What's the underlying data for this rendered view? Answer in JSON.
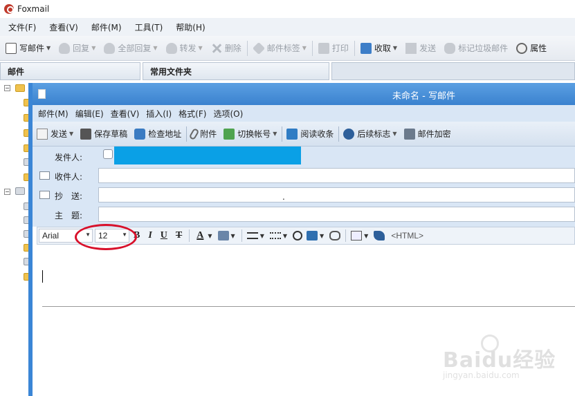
{
  "app": {
    "title": "Foxmail"
  },
  "menubar": [
    "文件(F)",
    "查看(V)",
    "邮件(M)",
    "工具(T)",
    "帮助(H)"
  ],
  "toolbar": {
    "write": "写邮件",
    "reply": "回复",
    "reply_all": "全部回复",
    "forward": "转发",
    "delete": "删除",
    "tag": "邮件标签",
    "print": "打印",
    "receive": "收取",
    "send": "发送",
    "spam": "标记垃圾邮件",
    "props": "属性"
  },
  "panels": {
    "mail": "邮件",
    "folders": "常用文件夹"
  },
  "compose": {
    "title": "未命名 - 写邮件",
    "menu": [
      "邮件(M)",
      "编辑(E)",
      "查看(V)",
      "插入(I)",
      "格式(F)",
      "选项(O)"
    ],
    "toolbar": {
      "send": "发送",
      "save_draft": "保存草稿",
      "check_address": "检查地址",
      "attach": "附件",
      "switch_account": "切换帐号",
      "read_receipt": "阅读收条",
      "follow_up": "后续标志",
      "encrypt": "邮件加密"
    },
    "fields": {
      "from": "发件人:",
      "to": "收件人:",
      "cc": "抄　送:",
      "subject": "主　题:"
    },
    "cc_value": ".",
    "format": {
      "font": "Arial",
      "size": "12",
      "bold": "B",
      "italic": "I",
      "underline": "U",
      "strike": "T",
      "font_color": "A",
      "html": "<HTML>"
    }
  },
  "watermark": {
    "brand": "Baidu经验",
    "url": "jingyan.baidu.com"
  }
}
